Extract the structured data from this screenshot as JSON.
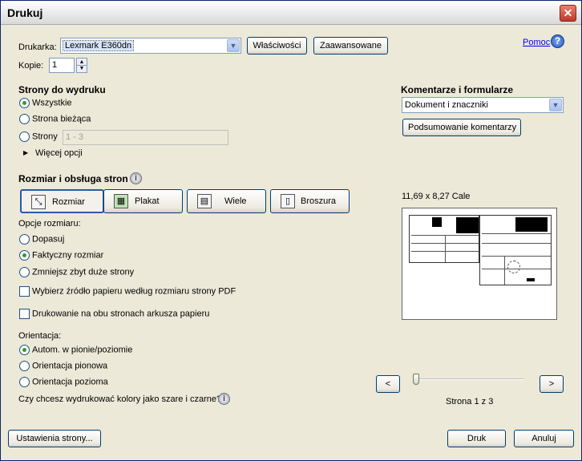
{
  "window": {
    "title": "Drukuj",
    "close_icon": "close-icon"
  },
  "printer": {
    "label": "Drukarka:",
    "selected": "Lexmark E360dn",
    "properties_label": "Właściwości",
    "advanced_label": "Zaawansowane",
    "help_label": "Pomoc",
    "help_icon": "help-icon"
  },
  "copies": {
    "label": "Kopie:",
    "value": "1"
  },
  "pages": {
    "title": "Strony do wydruku",
    "options": [
      "Wszystkie",
      "Strona bieżąca",
      "Strony"
    ],
    "selected_index": 0,
    "range_placeholder": "1 - 3",
    "more_options": "Więcej opcji"
  },
  "comments": {
    "title": "Komentarze i formularze",
    "selected": "Dokument i znaczniki",
    "summary_button": "Podsumowanie komentarzy"
  },
  "sizing": {
    "title": "Rozmiar i obsługa stron",
    "modes": [
      "Rozmiar",
      "Plakat",
      "Wiele",
      "Broszura"
    ],
    "active_mode": 0,
    "options_label": "Opcje rozmiaru:",
    "options": [
      "Dopasuj",
      "Faktyczny rozmiar",
      "Zmniejsz zbyt duże strony"
    ],
    "selected_index": 1,
    "paper_source_label": "Wybierz źródło papieru według rozmiaru strony PDF",
    "duplex_label": "Drukowanie na obu stronach arkusza papieru"
  },
  "orientation": {
    "label": "Orientacja:",
    "options": [
      "Autom. w pionie/poziomie",
      "Orientacja pionowa",
      "Orientacja pozioma"
    ],
    "selected_index": 0
  },
  "grayscale_question": "Czy chcesz wydrukować kolory jako szare i czarne?",
  "preview": {
    "size_label": "11,69 x 8,27 Cale",
    "page_label": "Strona 1 z 3",
    "prev_label": "<",
    "next_label": ">",
    "page_current": 1,
    "page_total": 3
  },
  "footer": {
    "page_setup_label": "Ustawienia strony...",
    "print_label": "Druk",
    "cancel_label": "Anuluj"
  }
}
